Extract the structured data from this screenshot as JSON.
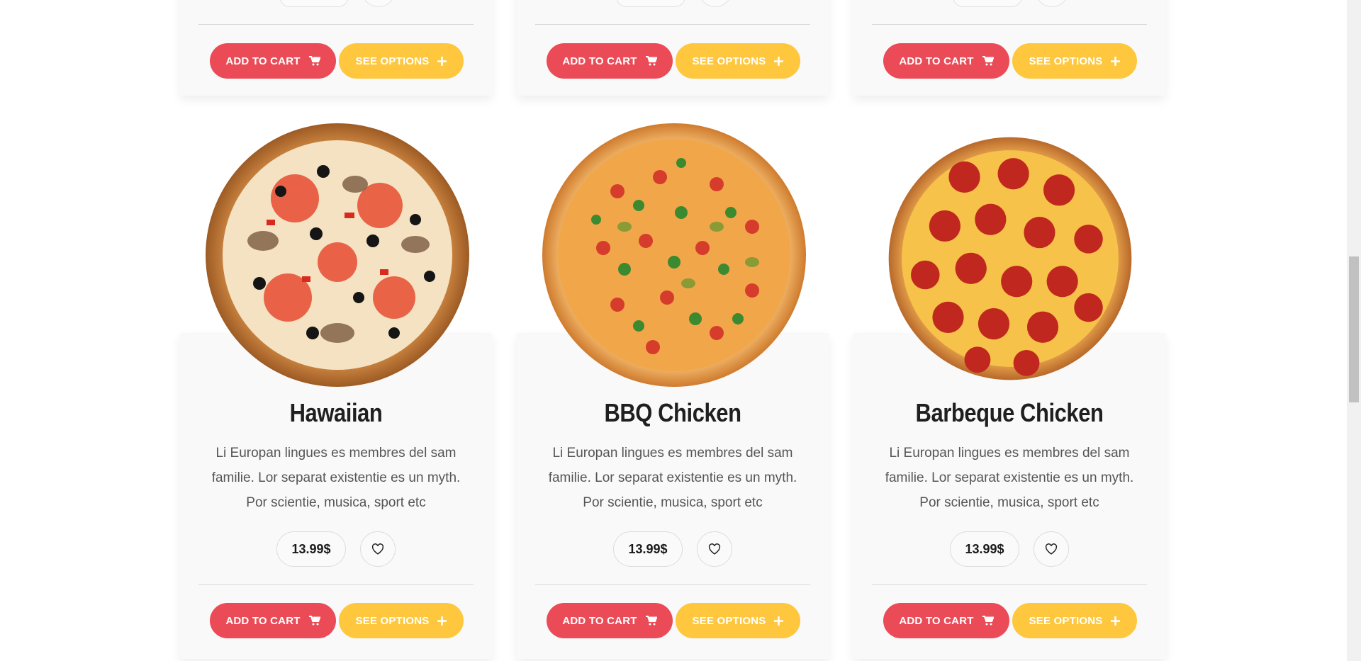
{
  "top_row": {
    "cards": [
      {
        "add_to_cart": "ADD TO CART",
        "see_options": "SEE OPTIONS"
      },
      {
        "add_to_cart": "ADD TO CART",
        "see_options": "SEE OPTIONS"
      },
      {
        "add_to_cart": "ADD TO CART",
        "see_options": "SEE OPTIONS"
      }
    ]
  },
  "products": [
    {
      "title": "Hawaiian",
      "description": "Li Europan lingues es membres del sam familie. Lor separat existentie es un myth. Por scientie, musica, sport etc",
      "price": "13.99$",
      "add_to_cart": "ADD TO CART",
      "see_options": "SEE OPTIONS",
      "image_icon": "pizza-vegetable-icon"
    },
    {
      "title": "BBQ Chicken",
      "description": "Li Europan lingues es membres del sam familie. Lor separat existentie es un myth. Por scientie, musica, sport etc",
      "price": "13.99$",
      "add_to_cart": "ADD TO CART",
      "see_options": "SEE OPTIONS",
      "image_icon": "pizza-bbq-icon"
    },
    {
      "title": "Barbeque Chicken",
      "description": "Li Europan lingues es membres del sam familie. Lor separat existentie es un myth. Por scientie, musica, sport etc",
      "price": "13.99$",
      "add_to_cart": "ADD TO CART",
      "see_options": "SEE OPTIONS",
      "image_icon": "pizza-pepperoni-icon"
    }
  ],
  "colors": {
    "add_to_cart": "#ea4b56",
    "see_options": "#fec73e",
    "card_bg": "#f9f9f9",
    "title": "#1f1f1f",
    "text": "#555555"
  }
}
